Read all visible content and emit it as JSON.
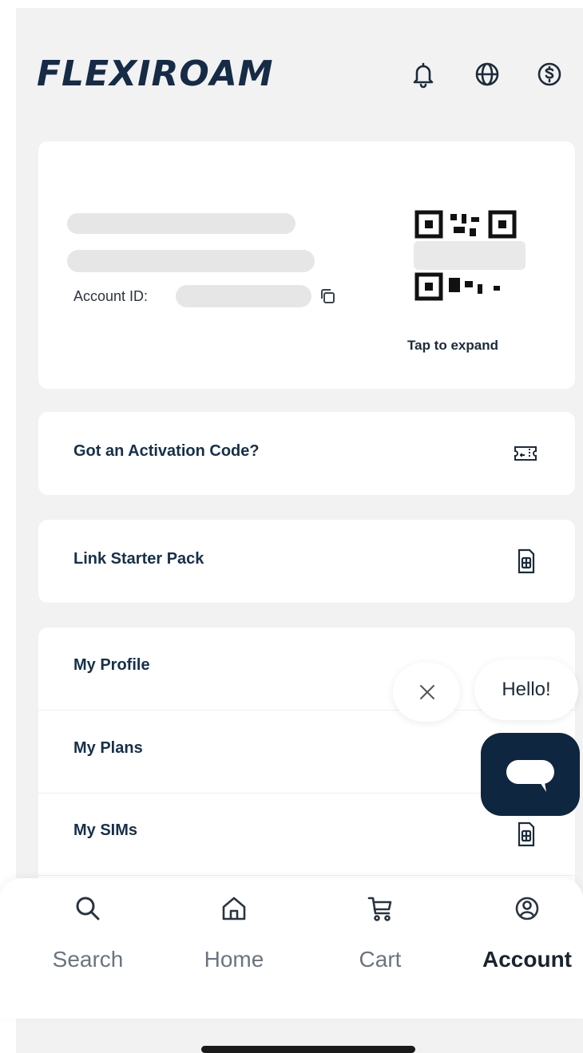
{
  "app": {
    "logo_text": "FLEXIROAM",
    "brand_color": "#162b46",
    "accent_dark": "#0f2640"
  },
  "header": {
    "icons": [
      "bell-icon",
      "globe-icon",
      "currency-icon"
    ]
  },
  "account_card": {
    "account_id_label": "Account ID:",
    "qr_hint": "Tap to expand"
  },
  "actions": [
    {
      "label": "Got an Activation Code?",
      "icon": "ticket-icon"
    },
    {
      "label": "Link Starter Pack",
      "icon": "sim-icon"
    }
  ],
  "menu": [
    {
      "label": "My Profile"
    },
    {
      "label": "My Plans"
    },
    {
      "label": "My SIMs",
      "icon": "sim-icon"
    }
  ],
  "chat": {
    "greeting": "Hello!"
  },
  "bottom_nav": {
    "items": [
      {
        "label": "Search",
        "icon": "search-icon"
      },
      {
        "label": "Home",
        "icon": "home-icon"
      },
      {
        "label": "Cart",
        "icon": "cart-icon"
      },
      {
        "label": "Account",
        "icon": "account-icon",
        "active": true
      }
    ]
  }
}
